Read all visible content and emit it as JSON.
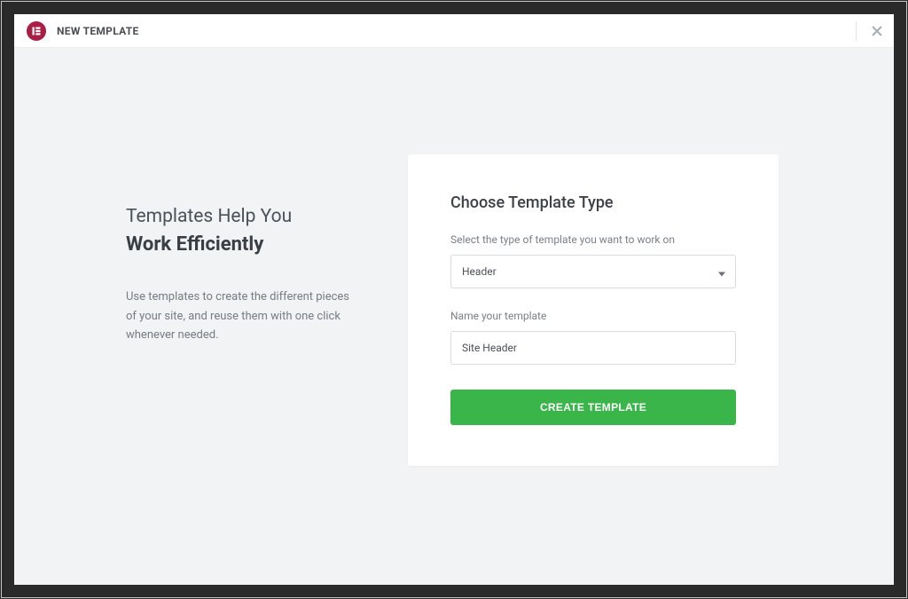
{
  "header": {
    "title": "NEW TEMPLATE"
  },
  "left": {
    "heading_line1": "Templates Help You",
    "heading_line2": "Work Efficiently",
    "description": "Use templates to create the different pieces of your site, and reuse them with one click whenever needed."
  },
  "form": {
    "title": "Choose Template Type",
    "type_label": "Select the type of template you want to work on",
    "type_value": "Header",
    "name_label": "Name your template",
    "name_value": "Site Header",
    "submit_label": "CREATE TEMPLATE"
  }
}
